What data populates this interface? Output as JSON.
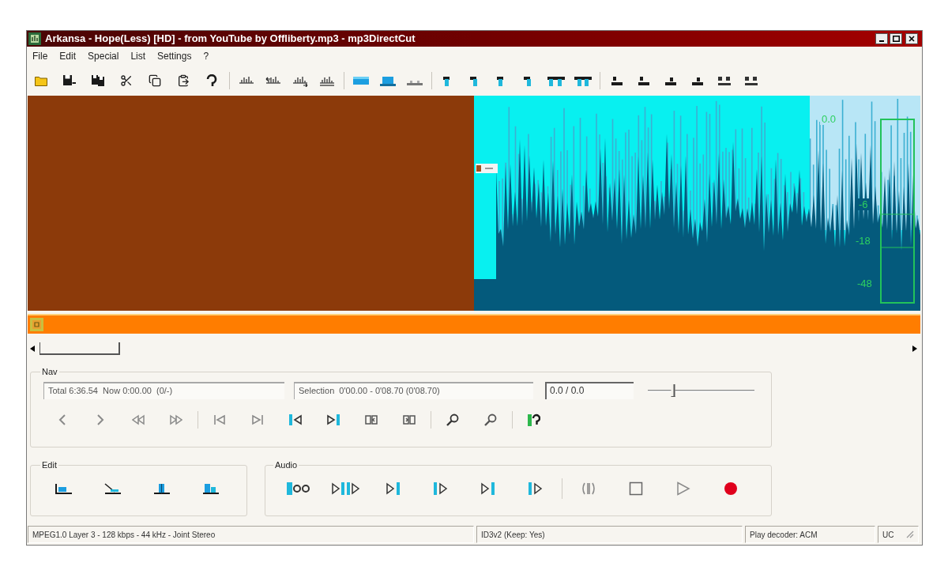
{
  "window": {
    "title": "Arkansa - Hope(Less) [HD] - from YouTube by Offliberty.mp3 - mp3DirectCut"
  },
  "menu": [
    {
      "label": "File"
    },
    {
      "label": "Edit"
    },
    {
      "label": "Special"
    },
    {
      "label": "List"
    },
    {
      "label": "Settings"
    },
    {
      "label": "?"
    }
  ],
  "waveform": {
    "meter_labels": [
      "0.0",
      "-6",
      "-18",
      "-48"
    ]
  },
  "nav": {
    "label": "Nav",
    "position": "Total 6:36.54  Now 0:00.00  (0/-)",
    "selection": "Selection  0'00.00 - 0'08.70 (0'08.70)",
    "volume": "0.0 / 0.0",
    "slider": {
      "level": 0.24
    }
  },
  "edit": {
    "label": "Edit"
  },
  "audio": {
    "label": "Audio"
  },
  "status_bar": [
    {
      "text": "MPEG1.0 Layer 3 - 128 kbps - 44 kHz - Joint Stereo"
    },
    {
      "text": "ID3v2 (Keep: Yes)"
    },
    {
      "text": "Play decoder: ACM"
    },
    {
      "text": "UC"
    }
  ]
}
